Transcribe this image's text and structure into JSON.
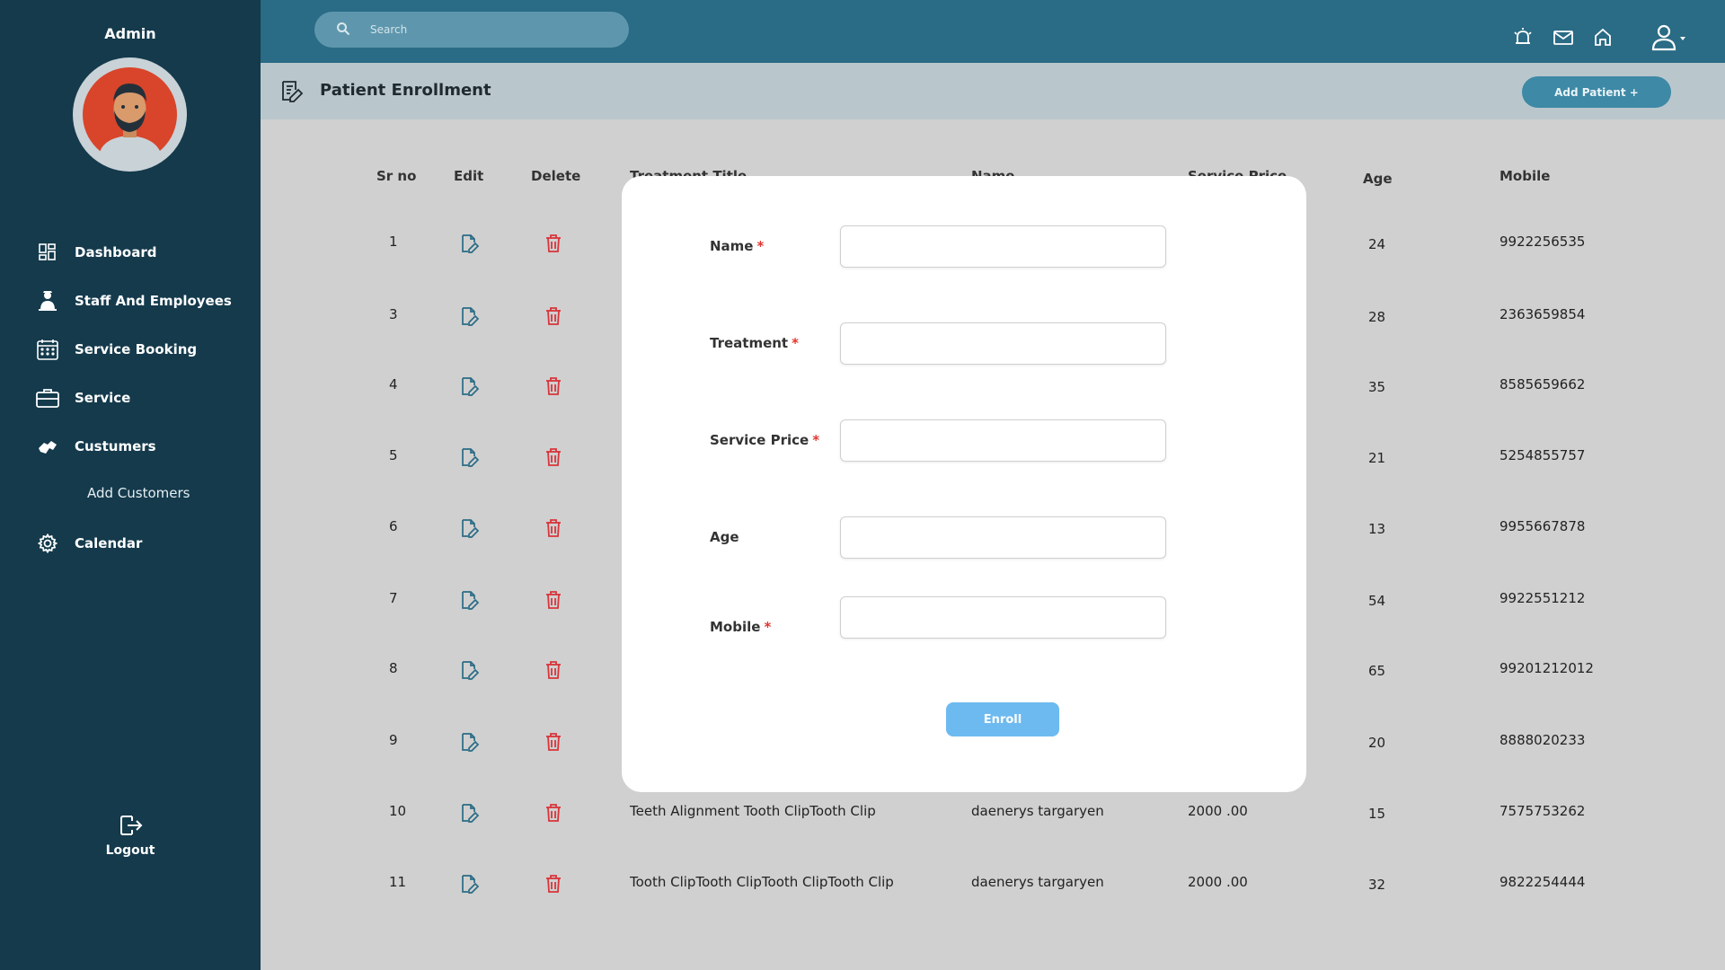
{
  "sidebar": {
    "admin_label": "Admin",
    "nav": [
      {
        "label": "Dashboard",
        "icon": "dashboard-icon"
      },
      {
        "label": "Staff And Employees",
        "icon": "staff-icon"
      },
      {
        "label": "Service Booking",
        "icon": "calendar-grid-icon"
      },
      {
        "label": "Service",
        "icon": "briefcase-icon"
      },
      {
        "label": "Custumers",
        "icon": "handshake-icon"
      },
      {
        "label": "Calendar",
        "icon": "gear-icon"
      }
    ],
    "sub_item": "Add Customers",
    "logout_label": "Logout"
  },
  "topbar": {
    "search_placeholder": "Search",
    "icons": [
      "alarm-icon",
      "mail-icon",
      "home-icon",
      "user-icon"
    ]
  },
  "header": {
    "title": "Patient Enrollment",
    "add_button": "Add Patient +"
  },
  "table": {
    "columns": [
      "Sr no",
      "Edit",
      "Delete",
      "Treatment Title",
      "Name",
      "Service Price",
      "Age",
      "Mobile"
    ],
    "rows": [
      {
        "sr": "1",
        "title": "",
        "name": "",
        "price": "",
        "age": "24",
        "mobile": "9922256535"
      },
      {
        "sr": "3",
        "title": "",
        "name": "",
        "price": "",
        "age": "28",
        "mobile": "2363659854"
      },
      {
        "sr": "4",
        "title": "",
        "name": "",
        "price": "",
        "age": "35",
        "mobile": "8585659662"
      },
      {
        "sr": "5",
        "title": "",
        "name": "",
        "price": "",
        "age": "21",
        "mobile": "5254855757"
      },
      {
        "sr": "6",
        "title": "",
        "name": "",
        "price": "",
        "age": "13",
        "mobile": "9955667878"
      },
      {
        "sr": "7",
        "title": "",
        "name": "",
        "price": "",
        "age": "54",
        "mobile": "9922551212"
      },
      {
        "sr": "8",
        "title": "",
        "name": "",
        "price": "",
        "age": "65",
        "mobile": "99201212012"
      },
      {
        "sr": "9",
        "title": "",
        "name": "",
        "price": "",
        "age": "20",
        "mobile": "8888020233"
      },
      {
        "sr": "10",
        "title": "Teeth Alignment Tooth ClipTooth Clip",
        "name": "daenerys targaryen",
        "price": "2000 .00",
        "age": "15",
        "mobile": "7575753262"
      },
      {
        "sr": "11",
        "title": "Tooth ClipTooth ClipTooth ClipTooth Clip",
        "name": "daenerys targaryen",
        "price": "2000 .00",
        "age": "32",
        "mobile": "9822254444"
      }
    ]
  },
  "modal": {
    "fields": [
      {
        "label": "Name",
        "required": "*",
        "value": ""
      },
      {
        "label": "Treatment",
        "required": "*",
        "value": ""
      },
      {
        "label": "Service Price",
        "required": "*",
        "value": ""
      },
      {
        "label": "Age",
        "required": "",
        "value": ""
      },
      {
        "label": "Mobile",
        "required": "*",
        "value": ""
      }
    ],
    "submit_label": "Enroll"
  },
  "colors": {
    "sidebar": "#143a4c",
    "topbar": "#2a6b85",
    "accent": "#3d89a6",
    "delete": "#d8343a",
    "edit": "#2a6b85",
    "enroll": "#6dbaf0",
    "required": "#e2362e"
  }
}
